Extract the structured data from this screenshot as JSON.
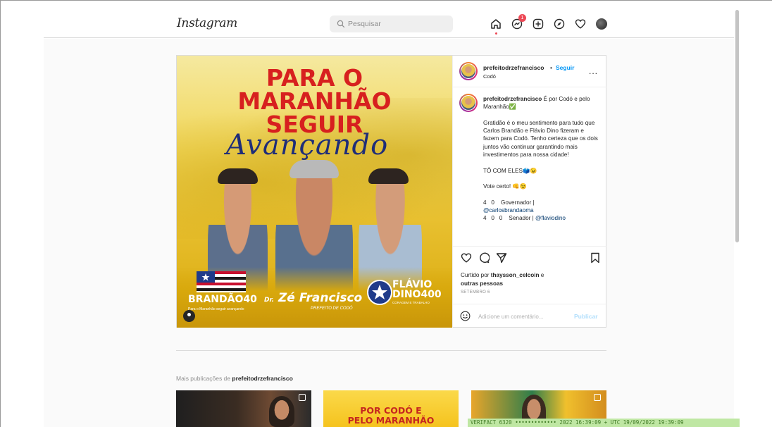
{
  "browser": {
    "top_caption": "https://www.instagram.com/p/..."
  },
  "header": {
    "logo": "Instagram",
    "search_placeholder": "Pesquisar",
    "notification_count": "1",
    "icons": [
      "home-icon",
      "messenger-icon",
      "new-post-icon",
      "explore-icon",
      "activity-heart-icon",
      "profile-avatar"
    ]
  },
  "post": {
    "image": {
      "line1": "PARA O",
      "line2": "MARANHÃO",
      "line3": "SEGUIR",
      "script": "Avançando",
      "brandao": "BRANDÃO40",
      "brandao_sub": "Para o Maranhão seguir avançando",
      "ze_prefix": "Dr.",
      "ze_name": "Zé Francisco",
      "ze_sub": "PREFEITO DE CODÓ",
      "flavio": "FLÁVIO",
      "flavio2": "DINO400",
      "flavio_sub": "CORAGEM E TRABALHO"
    },
    "header": {
      "username": "prefeitodrzefrancisco",
      "dot": "•",
      "follow": "Seguir",
      "location": "Codó",
      "more": "..."
    },
    "caption": {
      "username": "prefeitodrzefrancisco",
      "intro": "É por Codó e pelo Maranhão✅",
      "para1": "Gratidão é o meu sentimento para tudo que Carlos Brandão e Flávio Dino fizeram e fazem para Codó. Tenho certeza que os dois juntos vão continuar garantindo mais investimentos para nossa cidade!",
      "para2": "TÔ COM ELES🗳️😉",
      "para3": "Vote certo! 👊😉",
      "gov_line": "4   0    Governador |",
      "gov_handle": "@carlosbrandaoma",
      "sen_line": "4   0   0    Senador |",
      "sen_handle": "@flaviodino"
    },
    "likes": {
      "prefix": "Curtido por",
      "user": "thaysson_celcoin",
      "and": "e",
      "others": "outras pessoas"
    },
    "date": "SETEMBRO 6",
    "comment_placeholder": "Adicione um comentário...",
    "publish": "Publicar"
  },
  "more_posts": {
    "label": "Mais publicações de",
    "user": "prefeitodrzefrancisco",
    "thumb2_line1": "POR CODÓ E",
    "thumb2_line2": "PELO MARANHÃO"
  },
  "watermark": "VERIFACT 6320 ••••••••••••• 2022 16:39:09 + UTC 19/09/2022 19:39:09"
}
